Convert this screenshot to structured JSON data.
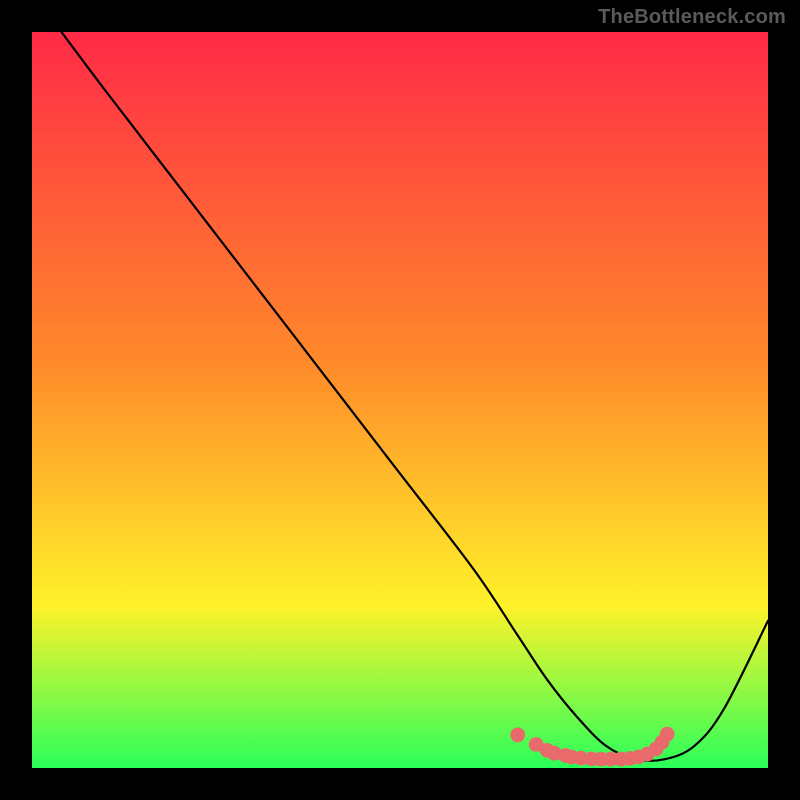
{
  "watermark": "TheBottleneck.com",
  "chart_data": {
    "type": "line",
    "title": "",
    "xlabel": "",
    "ylabel": "",
    "xlim": [
      0,
      100
    ],
    "ylim": [
      0,
      100
    ],
    "grid": false,
    "background_gradient": {
      "top": "#ff2a47",
      "mid1": "#ff8a2a",
      "mid2": "#fff22a",
      "bottom": "#2aff5a"
    },
    "series": [
      {
        "name": "bottleneck-curve",
        "color": "#000000",
        "x": [
          4,
          10,
          20,
          30,
          40,
          50,
          60,
          66,
          70,
          74,
          78,
          82,
          86,
          90,
          94,
          100
        ],
        "y": [
          100,
          92,
          79,
          66,
          53,
          40,
          27,
          18,
          12,
          7,
          3,
          1.2,
          1.2,
          3,
          8,
          20
        ]
      }
    ],
    "flat_region": {
      "color": "#e86a6a",
      "dot_radius": 1.0,
      "x": [
        66,
        68.5,
        70,
        71,
        72.5,
        73.3,
        74.6,
        76,
        77.3,
        78.6,
        80,
        81.2,
        82.4,
        83.6,
        84.8,
        85.6,
        86.3
      ],
      "y": [
        4.5,
        3.2,
        2.4,
        2.0,
        1.7,
        1.5,
        1.35,
        1.25,
        1.2,
        1.2,
        1.22,
        1.3,
        1.5,
        1.9,
        2.6,
        3.5,
        4.6
      ]
    }
  }
}
